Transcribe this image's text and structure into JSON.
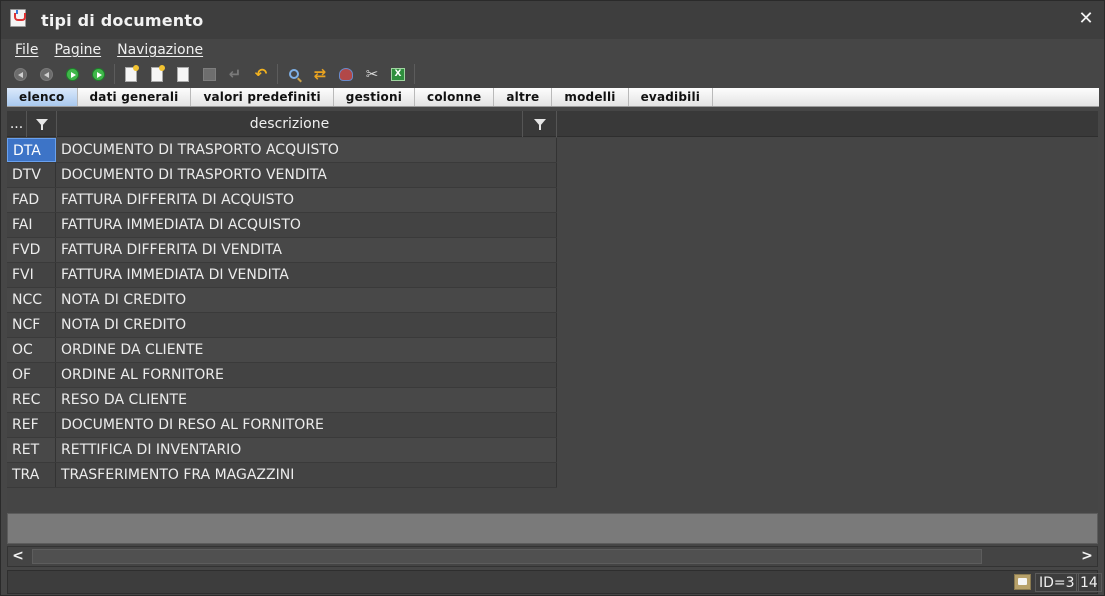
{
  "window": {
    "title": "tipi di documento",
    "close_icon": "close-icon"
  },
  "menu": {
    "items": [
      "File",
      "Pagine",
      "Navigazione"
    ]
  },
  "toolbar": {
    "icons": [
      "first-record-icon",
      "previous-record-icon",
      "next-record-icon",
      "last-record-icon",
      "new-document-icon",
      "duplicate-document-icon",
      "edit-document-icon",
      "save-icon",
      "cancel-icon",
      "undo-icon",
      "search-icon",
      "refresh-icon",
      "filter-search-icon",
      "tools-icon",
      "excel-export-icon"
    ]
  },
  "tabs": [
    "elenco",
    "dati generali",
    "valori predefiniti",
    "gestioni",
    "colonne",
    "altre",
    "modelli",
    "evadibili"
  ],
  "grid": {
    "columns": [
      "...",
      "descrizione"
    ],
    "rows": [
      {
        "code": "DTA",
        "desc": "DOCUMENTO DI TRASPORTO ACQUISTO"
      },
      {
        "code": "DTV",
        "desc": "DOCUMENTO DI TRASPORTO VENDITA"
      },
      {
        "code": "FAD",
        "desc": "FATTURA DIFFERITA DI ACQUISTO"
      },
      {
        "code": "FAI",
        "desc": "FATTURA IMMEDIATA DI ACQUISTO"
      },
      {
        "code": "FVD",
        "desc": "FATTURA DIFFERITA DI VENDITA"
      },
      {
        "code": "FVI",
        "desc": "FATTURA IMMEDIATA DI VENDITA"
      },
      {
        "code": "NCC",
        "desc": "NOTA DI CREDITO"
      },
      {
        "code": "NCF",
        "desc": "NOTA DI CREDITO"
      },
      {
        "code": "OC",
        "desc": "ORDINE DA CLIENTE"
      },
      {
        "code": "OF",
        "desc": "ORDINE AL FORNITORE"
      },
      {
        "code": "REC",
        "desc": "RESO DA CLIENTE"
      },
      {
        "code": "REF",
        "desc": "DOCUMENTO DI RESO AL FORNITORE"
      },
      {
        "code": "RET",
        "desc": "RETTIFICA DI INVENTARIO"
      },
      {
        "code": "TRA",
        "desc": "TRASFERIMENTO FRA MAGAZZINI"
      }
    ]
  },
  "status": {
    "id_text": "ID=3",
    "count": "14"
  },
  "colors": {
    "selection": "#3d74c7",
    "active_tab": "#a9c9ef"
  }
}
